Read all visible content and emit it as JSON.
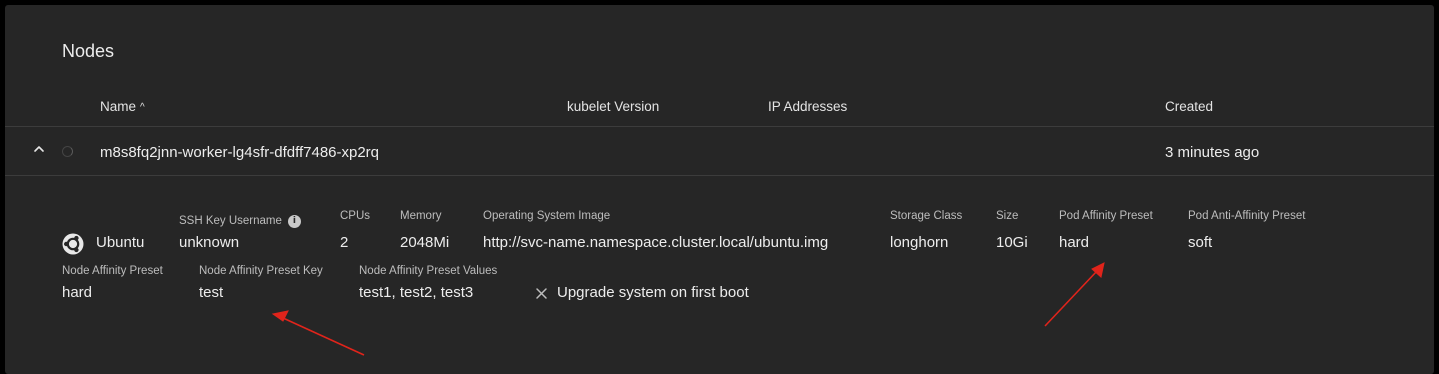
{
  "section": {
    "title": "Nodes"
  },
  "table": {
    "headers": {
      "name": "Name",
      "kubelet_version": "kubelet Version",
      "ip_addresses": "IP Addresses",
      "created": "Created"
    },
    "sort_icon": "caret-up",
    "rows": [
      {
        "name": "m8s8fq2jnn-worker-lg4sfr-dfdff7486-xp2rq",
        "kubelet_version": "",
        "ip_addresses": "",
        "created": "3 minutes ago",
        "expanded": true
      }
    ]
  },
  "details": {
    "os": {
      "name": "Ubuntu",
      "icon": "ubuntu-logo"
    },
    "ssh_key_username": {
      "label": "SSH Key Username",
      "value": "unknown"
    },
    "cpus": {
      "label": "CPUs",
      "value": "2"
    },
    "memory": {
      "label": "Memory",
      "value": "2048Mi"
    },
    "os_image": {
      "label": "Operating System Image",
      "value": "http://svc-name.namespace.cluster.local/ubuntu.img"
    },
    "storage_class": {
      "label": "Storage Class",
      "value": "longhorn"
    },
    "size": {
      "label": "Size",
      "value": "10Gi"
    },
    "pod_affinity_preset": {
      "label": "Pod Affinity Preset",
      "value": "hard"
    },
    "pod_anti_affinity_preset": {
      "label": "Pod Anti-Affinity Preset",
      "value": "soft"
    },
    "node_affinity_preset": {
      "label": "Node Affinity Preset",
      "value": "hard"
    },
    "node_affinity_preset_key": {
      "label": "Node Affinity Preset Key",
      "value": "test"
    },
    "node_affinity_preset_values": {
      "label": "Node Affinity Preset Values",
      "value": "test1, test2, test3"
    },
    "upgrade_system": {
      "label": "Upgrade system on first boot",
      "enabled": false
    }
  },
  "colors": {
    "background": "#262626",
    "annotation_arrow": "#e0241b",
    "divider": "#3c3c3c"
  }
}
